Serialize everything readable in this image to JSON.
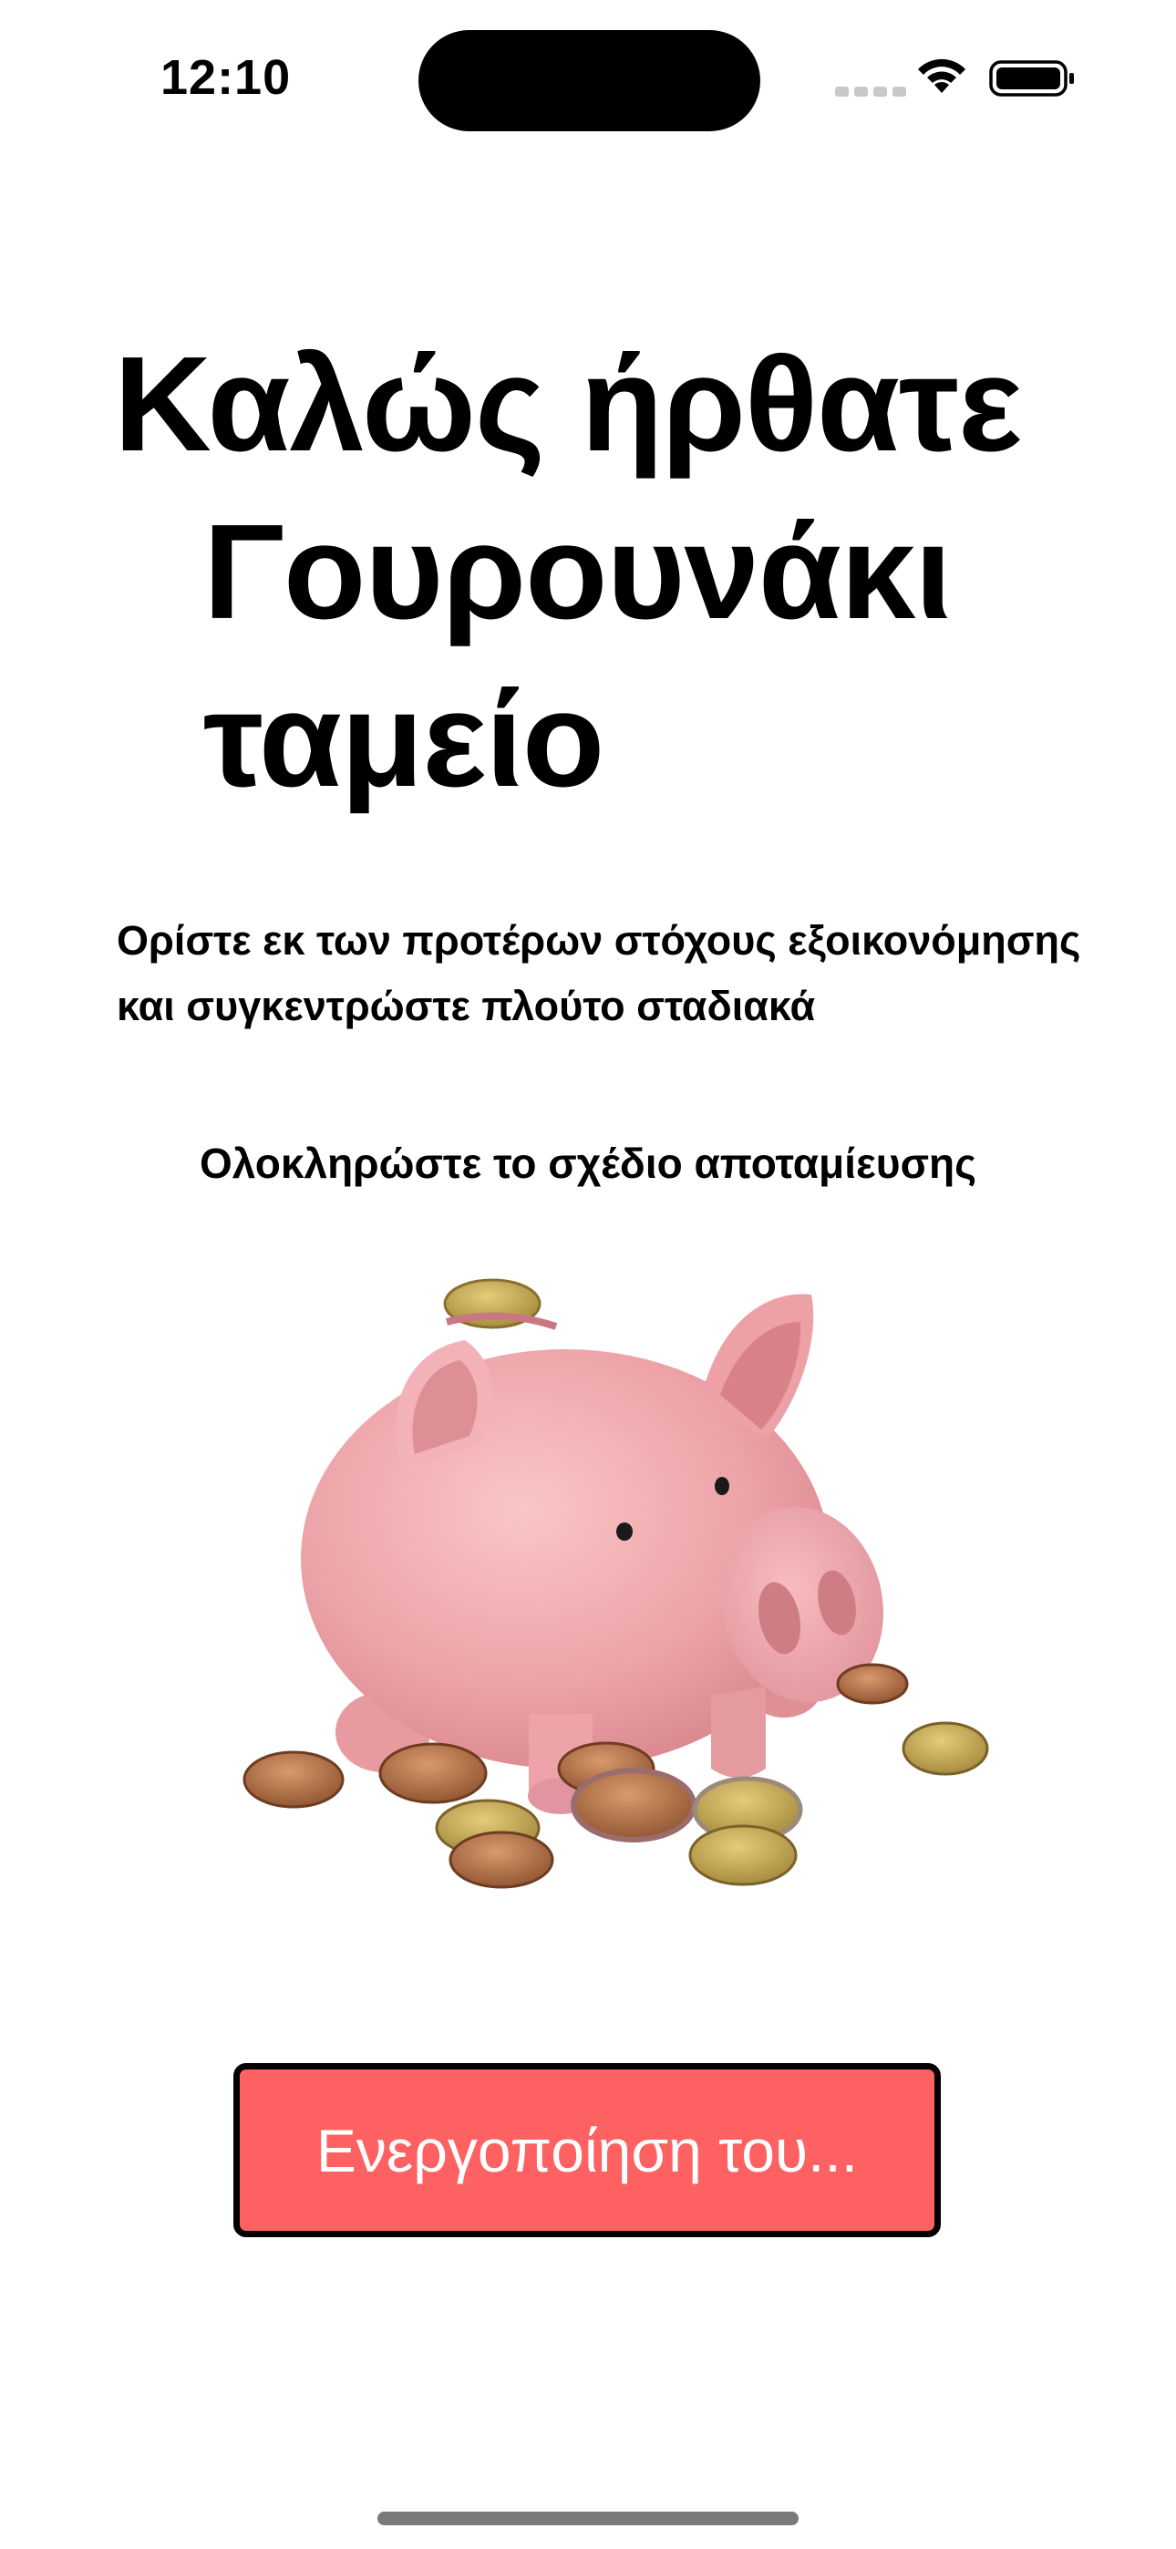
{
  "status_bar": {
    "time": "12:10",
    "icons": [
      "cellular-signal-icon",
      "wifi-icon",
      "battery-icon"
    ]
  },
  "title": {
    "line1": "Καλώς ήρθατε",
    "line2": "Γουρουνάκι",
    "line3": "ταμείο"
  },
  "description": "Ορίστε εκ των προτέρων στόχους εξοικονόμησης και συγκεντρώστε πλούτο σταδιακά",
  "subtitle": "Ολοκληρώστε το σχέδιο αποταμίευσης",
  "illustration": {
    "subject": "piggy-bank-with-coins-illustration"
  },
  "button": {
    "label": "Ενεργοποίηση του...",
    "background": "#fe6161",
    "border": "#000000",
    "text_color": "#ffffff"
  },
  "colors": {
    "background": "#ffffff",
    "text": "#000000",
    "accent": "#fe6161"
  }
}
